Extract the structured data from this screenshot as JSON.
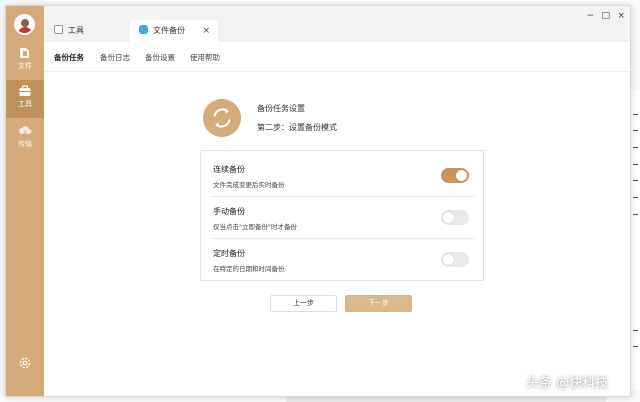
{
  "sidebar": {
    "items": [
      {
        "label": "文件",
        "icon": "folder-icon"
      },
      {
        "label": "工具",
        "icon": "toolbox-icon"
      },
      {
        "label": "传输",
        "icon": "cloud-transfer-icon"
      }
    ],
    "active_index": 1,
    "color": "#d4ab79",
    "active_color": "#bf925c"
  },
  "tabs": [
    {
      "label": "工具",
      "icon": "tool-tab-icon"
    },
    {
      "label": "文件备份",
      "icon": "backup-tab-icon",
      "close": "×"
    }
  ],
  "window_controls": {
    "minimize": "−",
    "maximize": "□",
    "close": "×"
  },
  "subnav": {
    "items": [
      "备份任务",
      "备份日志",
      "备份设置",
      "使用帮助"
    ],
    "active_index": 0
  },
  "hero": {
    "title": "备份任务设置",
    "step": "第二步：设置备份模式",
    "icon": "sync-icon"
  },
  "options": [
    {
      "title": "连续备份",
      "desc": "文件完成变更后实时备份",
      "enabled": true
    },
    {
      "title": "手动备份",
      "desc": "仅当点击\"立即备份\"时才备份",
      "enabled": false
    },
    {
      "title": "定时备份",
      "desc": "在特定的日期和时间备份",
      "enabled": false
    }
  ],
  "buttons": {
    "prev": "上一步",
    "next": "下一步"
  },
  "accent": "#c8955a",
  "watermark": "头条 @快科技"
}
